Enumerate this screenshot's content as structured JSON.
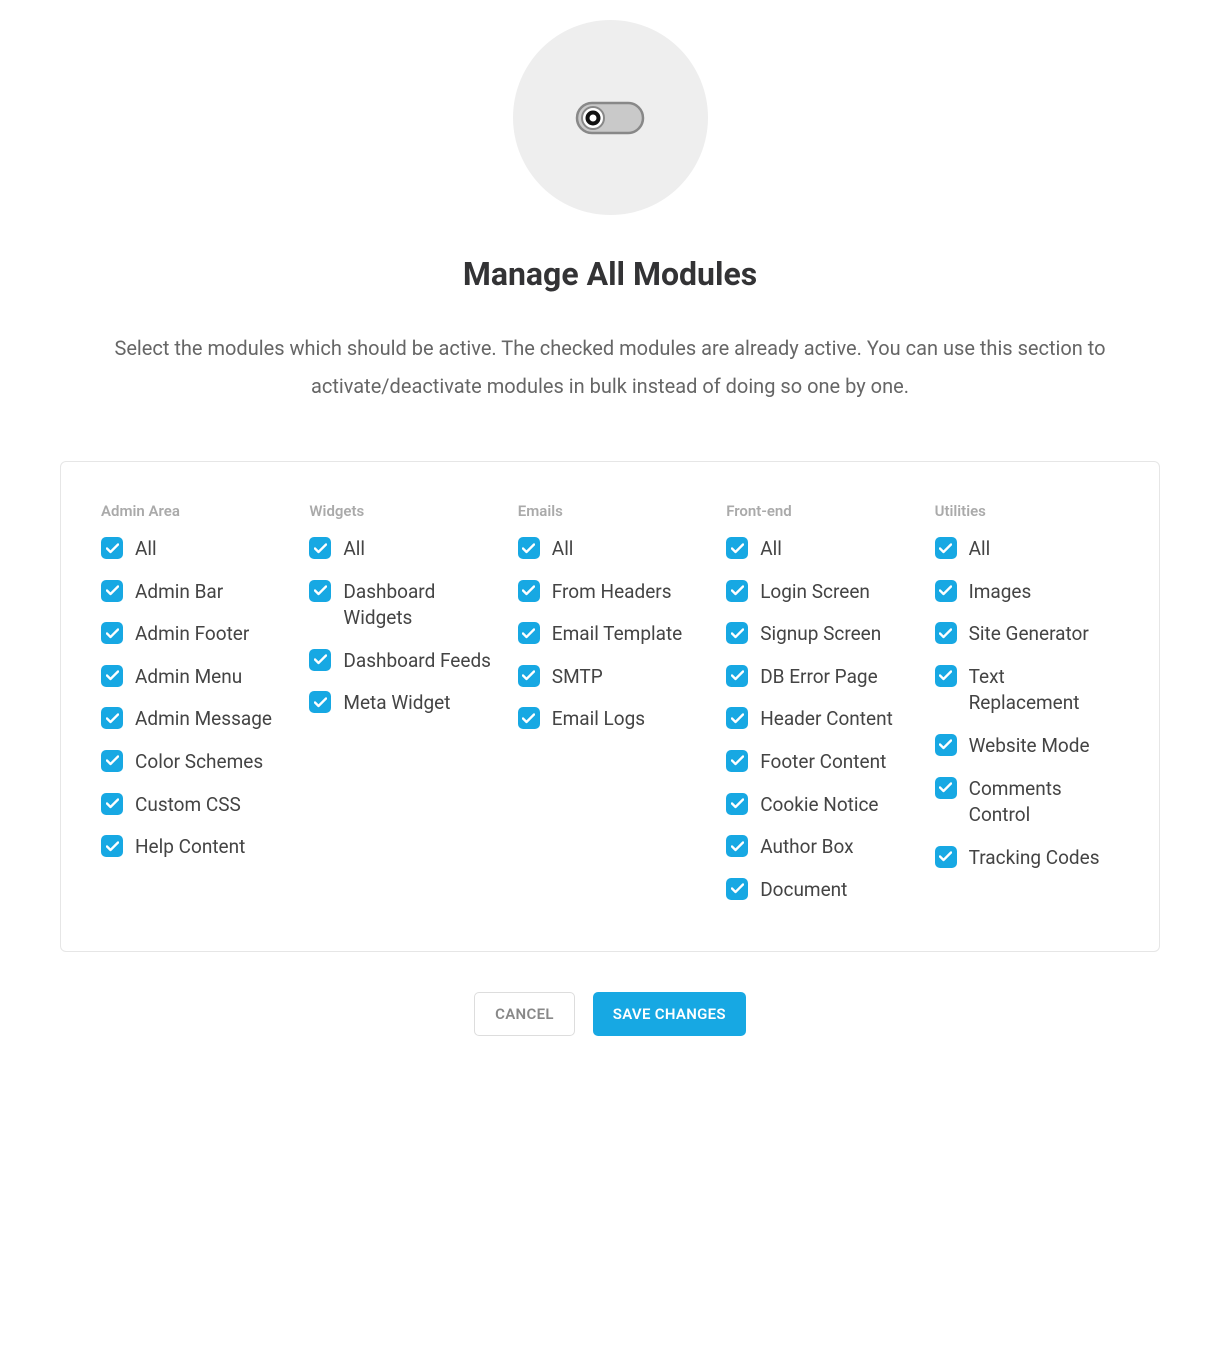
{
  "header": {
    "title": "Manage All Modules",
    "description": "Select the modules which should be active. The checked modules are already active. You can use this section to activate/deactivate modules in bulk instead of doing so one by one."
  },
  "columns": [
    {
      "name": "Admin Area",
      "items": [
        {
          "label": "All",
          "checked": true
        },
        {
          "label": "Admin Bar",
          "checked": true
        },
        {
          "label": "Admin Footer",
          "checked": true
        },
        {
          "label": "Admin Menu",
          "checked": true
        },
        {
          "label": "Admin Message",
          "checked": true
        },
        {
          "label": "Color Schemes",
          "checked": true
        },
        {
          "label": "Custom CSS",
          "checked": true
        },
        {
          "label": "Help Content",
          "checked": true
        }
      ]
    },
    {
      "name": "Widgets",
      "items": [
        {
          "label": "All",
          "checked": true
        },
        {
          "label": "Dashboard Widgets",
          "checked": true
        },
        {
          "label": "Dashboard Feeds",
          "checked": true
        },
        {
          "label": "Meta Widget",
          "checked": true
        }
      ]
    },
    {
      "name": "Emails",
      "items": [
        {
          "label": "All",
          "checked": true
        },
        {
          "label": "From Headers",
          "checked": true
        },
        {
          "label": "Email Template",
          "checked": true
        },
        {
          "label": "SMTP",
          "checked": true
        },
        {
          "label": "Email Logs",
          "checked": true
        }
      ]
    },
    {
      "name": "Front-end",
      "items": [
        {
          "label": "All",
          "checked": true
        },
        {
          "label": "Login Screen",
          "checked": true
        },
        {
          "label": "Signup Screen",
          "checked": true
        },
        {
          "label": "DB Error Page",
          "checked": true
        },
        {
          "label": "Header Content",
          "checked": true
        },
        {
          "label": "Footer Content",
          "checked": true
        },
        {
          "label": "Cookie Notice",
          "checked": true
        },
        {
          "label": "Author Box",
          "checked": true
        },
        {
          "label": "Document",
          "checked": true
        }
      ]
    },
    {
      "name": "Utilities",
      "items": [
        {
          "label": "All",
          "checked": true
        },
        {
          "label": "Images",
          "checked": true
        },
        {
          "label": "Site Generator",
          "checked": true
        },
        {
          "label": "Text Replacement",
          "checked": true
        },
        {
          "label": "Website Mode",
          "checked": true
        },
        {
          "label": "Comments Control",
          "checked": true
        },
        {
          "label": "Tracking Codes",
          "checked": true
        }
      ]
    }
  ],
  "actions": {
    "cancel": "CANCEL",
    "save": "SAVE CHANGES"
  }
}
